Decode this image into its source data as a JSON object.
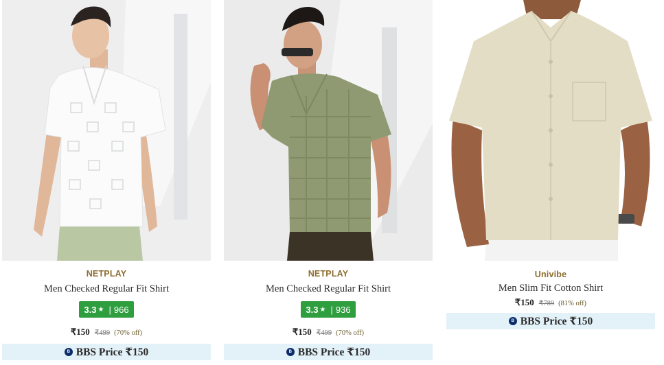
{
  "products": [
    {
      "brand": "NETPLAY",
      "title": "Men Checked Regular Fit Shirt",
      "rating": "3.3",
      "rating_count": "966",
      "price": "₹150",
      "mrp": "₹499",
      "discount": "(70% off)",
      "bbs_label": "BBS Price ₹150",
      "image_icon": "white-checked-shirt-image"
    },
    {
      "brand": "NETPLAY",
      "title": "Men Checked Regular Fit Shirt",
      "rating": "3.3",
      "rating_count": "936",
      "price": "₹150",
      "mrp": "₹499",
      "discount": "(70% off)",
      "bbs_label": "BBS Price ₹150",
      "image_icon": "olive-checked-shirt-image"
    },
    {
      "brand": "Univibe",
      "title": "Men Slim Fit Cotton Shirt",
      "price": "₹150",
      "mrp": "₹789",
      "discount": "(81% off)",
      "bbs_label": "BBS Price ₹150",
      "image_icon": "beige-cotton-shirt-image"
    }
  ],
  "colors": {
    "brand_text": "#8c6d2f",
    "rating_badge": "#2e9e3f",
    "bbs_bar": "#e3f1f8",
    "bbs_icon": "#0c2d6b"
  }
}
